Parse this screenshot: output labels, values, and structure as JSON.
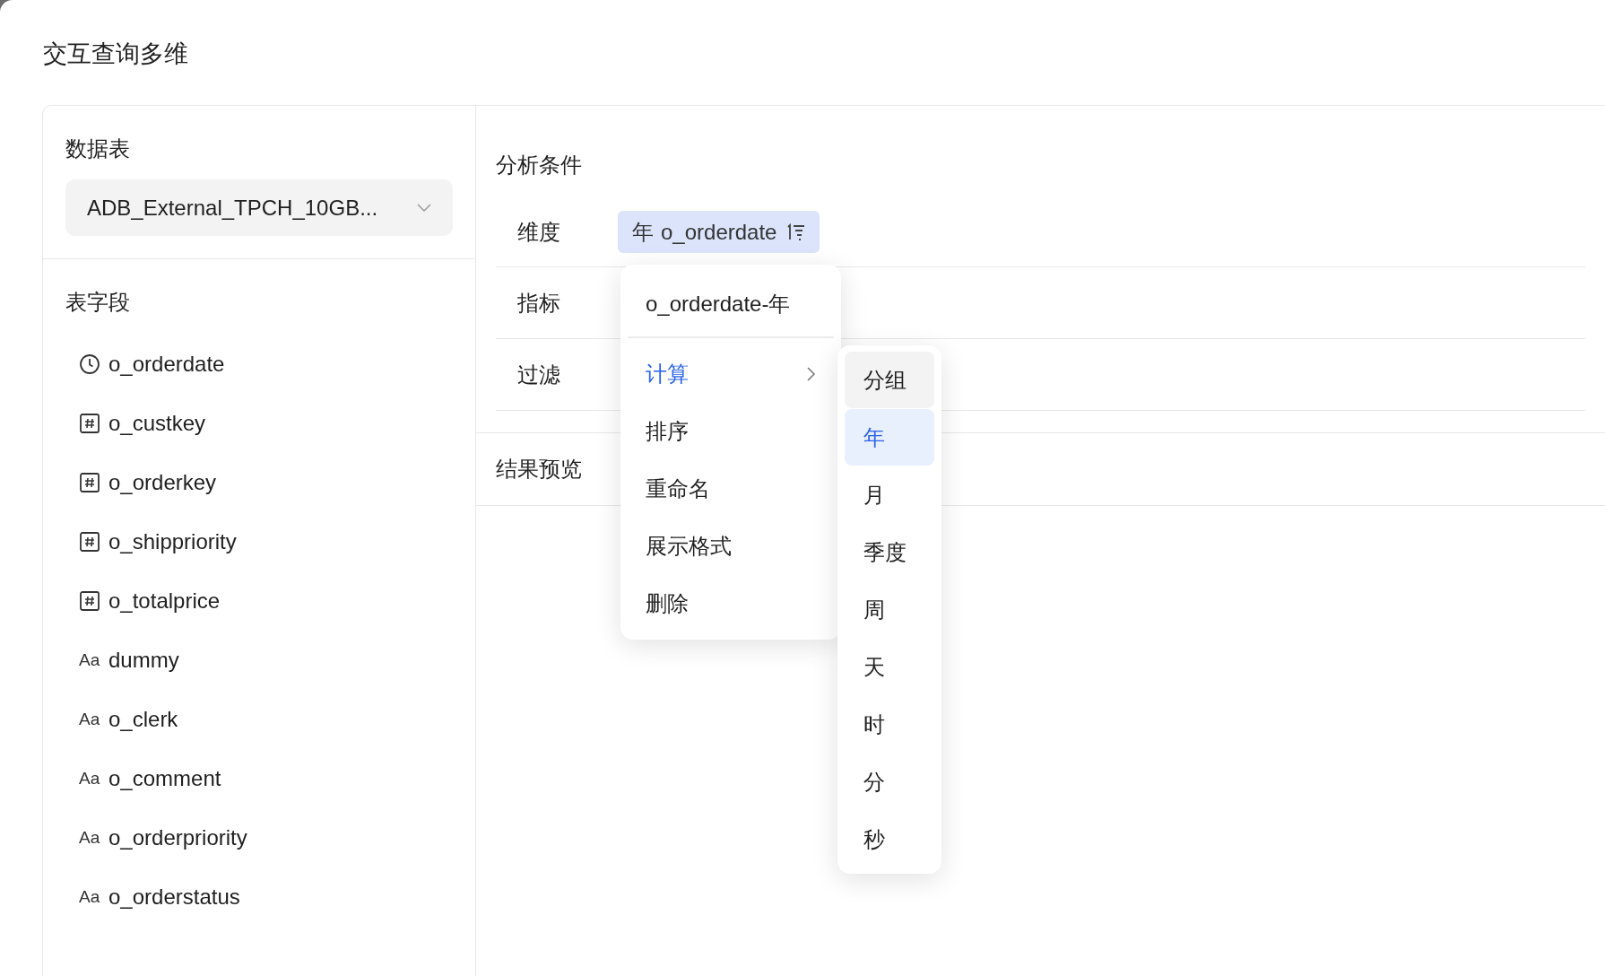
{
  "page_title": "交互查询多维",
  "data_table": {
    "label": "数据表",
    "value": "ADB_External_TPCH_10GB..."
  },
  "fields": {
    "label": "表字段",
    "items": [
      {
        "kind": "date",
        "name": "o_orderdate"
      },
      {
        "kind": "number",
        "name": "o_custkey"
      },
      {
        "kind": "number",
        "name": "o_orderkey"
      },
      {
        "kind": "number",
        "name": "o_shippriority"
      },
      {
        "kind": "number",
        "name": "o_totalprice"
      },
      {
        "kind": "text",
        "icon_text": "Aa",
        "name": "dummy"
      },
      {
        "kind": "text",
        "icon_text": "Aa",
        "name": "o_clerk"
      },
      {
        "kind": "text",
        "icon_text": "Aa",
        "name": "o_comment"
      },
      {
        "kind": "text",
        "icon_text": "Aa",
        "name": "o_orderpriority"
      },
      {
        "kind": "text",
        "icon_text": "Aa",
        "name": "o_orderstatus"
      }
    ]
  },
  "analysis": {
    "title": "分析条件",
    "rows": [
      {
        "label": "维度",
        "chips": [
          {
            "prefix": "年",
            "name": "o_orderdate"
          }
        ]
      },
      {
        "label": "指标"
      },
      {
        "label": "过滤"
      }
    ]
  },
  "result_preview": {
    "title": "结果预览"
  },
  "context_menu": {
    "header": "o_orderdate-年",
    "items": [
      {
        "label": "计算",
        "active": true,
        "submenu": true
      },
      {
        "label": "排序",
        "active": false,
        "submenu": false
      },
      {
        "label": "重命名",
        "active": false,
        "submenu": false
      },
      {
        "label": "展示格式",
        "active": false,
        "submenu": false
      },
      {
        "label": "删除",
        "active": false,
        "submenu": false
      }
    ]
  },
  "submenu": {
    "items": [
      {
        "label": "分组",
        "hovered": true,
        "selected": false
      },
      {
        "label": "年",
        "hovered": false,
        "selected": true
      },
      {
        "label": "月",
        "hovered": false,
        "selected": false
      },
      {
        "label": "季度",
        "hovered": false,
        "selected": false
      },
      {
        "label": "周",
        "hovered": false,
        "selected": false
      },
      {
        "label": "天",
        "hovered": false,
        "selected": false
      },
      {
        "label": "时",
        "hovered": false,
        "selected": false
      },
      {
        "label": "分",
        "hovered": false,
        "selected": false
      },
      {
        "label": "秒",
        "hovered": false,
        "selected": false
      }
    ]
  }
}
